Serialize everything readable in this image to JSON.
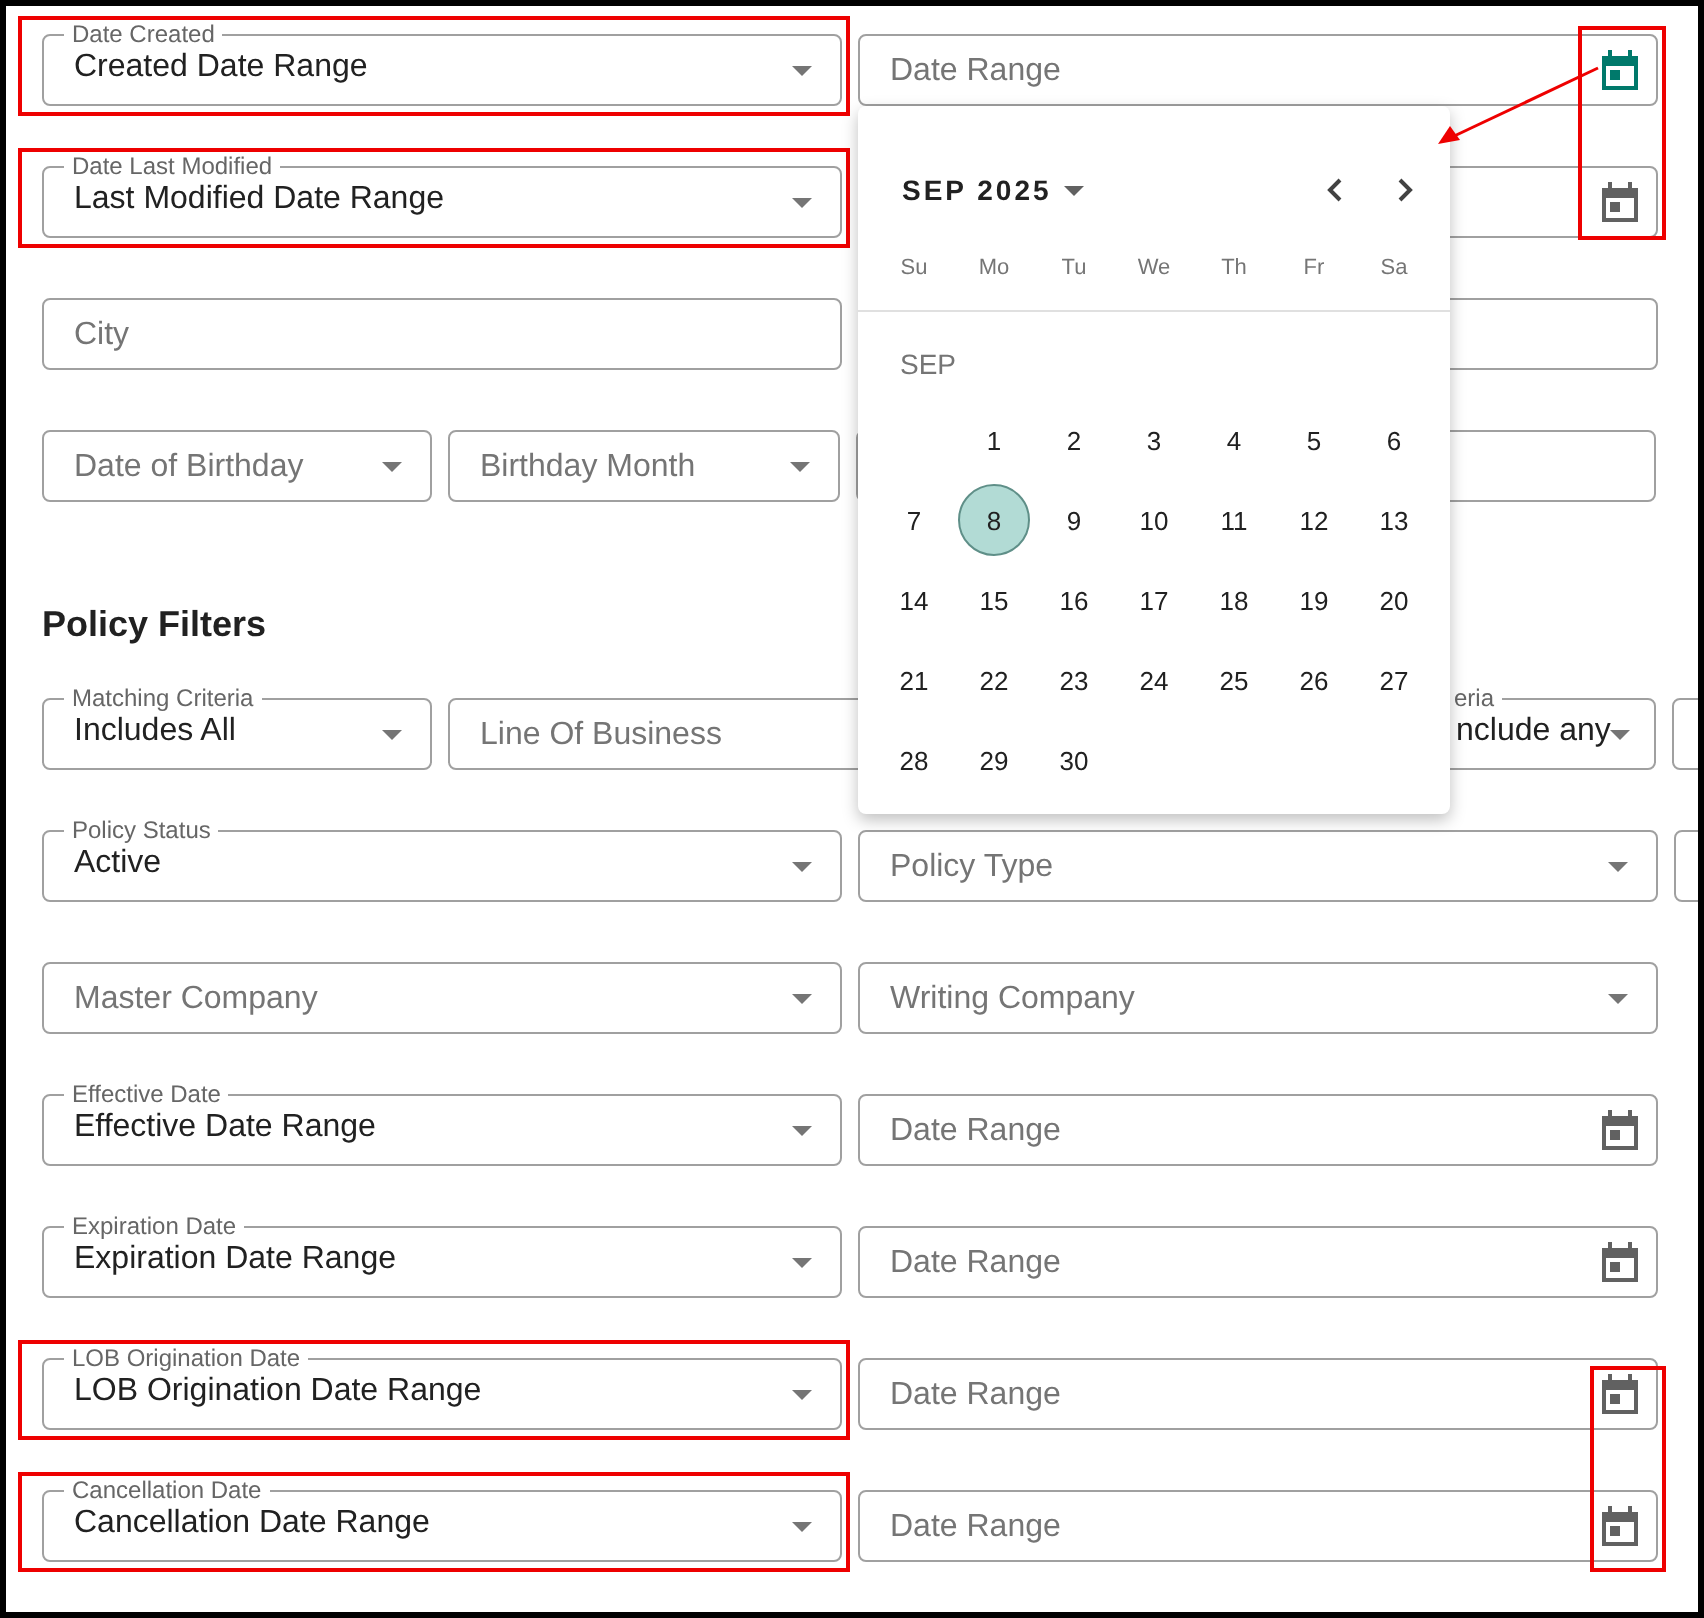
{
  "contact_rows": [
    {
      "kind": "pair",
      "fields": [
        {
          "kind": "select",
          "label": "Date Created",
          "value": "Created Date Range",
          "highlighted": true
        },
        {
          "kind": "date",
          "placeholder": "Date Range",
          "active": true
        }
      ]
    },
    {
      "kind": "pair",
      "fields": [
        {
          "kind": "select",
          "label": "Date Last Modified",
          "value": "Last Modified Date Range",
          "highlighted": true
        },
        {
          "kind": "date",
          "active": false
        }
      ]
    },
    {
      "kind": "pair",
      "fields": [
        {
          "kind": "text",
          "placeholder": "City"
        },
        {
          "kind": "text"
        }
      ]
    },
    {
      "kind": "birthday",
      "fields": [
        {
          "kind": "select",
          "placeholder": "Date of Birthday",
          "highlighted": false
        },
        {
          "kind": "select",
          "placeholder": "Birthday Month",
          "highlighted": false
        },
        {
          "kind": "text"
        }
      ]
    }
  ],
  "policy_heading": "Policy Filters",
  "policy_rows": [
    {
      "kind": "matching",
      "fields": [
        {
          "kind": "select",
          "label": "Matching Criteria",
          "value": "Includes All",
          "highlighted": false
        },
        {
          "kind": "text",
          "placeholder": "Line Of Business"
        },
        {
          "kind": "select",
          "label": "eria",
          "value": "nclude any",
          "highlighted": false
        },
        {
          "kind": "text"
        }
      ]
    },
    {
      "kind": "triple",
      "fields": [
        {
          "kind": "select",
          "label": "Policy Status",
          "value": "Active",
          "highlighted": false
        },
        {
          "kind": "select",
          "placeholder": "Policy Type",
          "highlighted": false
        },
        {
          "kind": "text"
        }
      ]
    },
    {
      "kind": "pair",
      "fields": [
        {
          "kind": "select",
          "placeholder": "Master Company",
          "highlighted": false
        },
        {
          "kind": "select",
          "placeholder": "Writing Company",
          "highlighted": false
        }
      ]
    },
    {
      "kind": "pair",
      "fields": [
        {
          "kind": "select",
          "label": "Effective Date",
          "value": "Effective Date Range",
          "highlighted": false
        },
        {
          "kind": "date",
          "placeholder": "Date Range",
          "active": false
        }
      ]
    },
    {
      "kind": "pair",
      "fields": [
        {
          "kind": "select",
          "label": "Expiration Date",
          "value": "Expiration Date Range",
          "highlighted": false
        },
        {
          "kind": "date",
          "placeholder": "Date Range",
          "active": false
        }
      ]
    },
    {
      "kind": "pair",
      "fields": [
        {
          "kind": "select",
          "label": "LOB Origination Date",
          "value": "LOB Origination Date Range",
          "highlighted": true
        },
        {
          "kind": "date",
          "placeholder": "Date Range",
          "active": false
        }
      ]
    },
    {
      "kind": "pair",
      "fields": [
        {
          "kind": "select",
          "label": "Cancellation Date",
          "value": "Cancellation Date Range",
          "highlighted": true
        },
        {
          "kind": "date",
          "placeholder": "Date Range",
          "active": false
        }
      ]
    }
  ],
  "date_picker": {
    "month_label": "SEP 2025",
    "weekdays": [
      "Su",
      "Mo",
      "Tu",
      "We",
      "Th",
      "Fr",
      "Sa"
    ],
    "month_heading": "SEP",
    "weeks": [
      [
        {
          "label": "1",
          "selected": false
        },
        {
          "label": "2",
          "selected": false
        },
        {
          "label": "3",
          "selected": false
        },
        {
          "label": "4",
          "selected": false
        },
        {
          "label": "5",
          "selected": false
        },
        {
          "label": "6",
          "selected": false
        }
      ],
      [
        {
          "label": "7",
          "selected": false
        },
        {
          "label": "8",
          "selected": true
        },
        {
          "label": "9",
          "selected": false
        },
        {
          "label": "10",
          "selected": false
        },
        {
          "label": "11",
          "selected": false
        },
        {
          "label": "12",
          "selected": false
        },
        {
          "label": "13",
          "selected": false
        }
      ],
      [
        {
          "label": "14",
          "selected": false
        },
        {
          "label": "15",
          "selected": false
        },
        {
          "label": "16",
          "selected": false
        },
        {
          "label": "17",
          "selected": false
        },
        {
          "label": "18",
          "selected": false
        },
        {
          "label": "19",
          "selected": false
        },
        {
          "label": "20",
          "selected": false
        }
      ],
      [
        {
          "label": "21",
          "selected": false
        },
        {
          "label": "22",
          "selected": false
        },
        {
          "label": "23",
          "selected": false
        },
        {
          "label": "24",
          "selected": false
        },
        {
          "label": "25",
          "selected": false
        },
        {
          "label": "26",
          "selected": false
        },
        {
          "label": "27",
          "selected": false
        }
      ],
      [
        {
          "label": "28",
          "selected": false
        },
        {
          "label": "29",
          "selected": false
        },
        {
          "label": "30",
          "selected": false
        }
      ]
    ]
  },
  "annotations": [
    {
      "kind": "icon-box"
    },
    {
      "kind": "arrow"
    },
    {
      "kind": "icon-box"
    }
  ]
}
